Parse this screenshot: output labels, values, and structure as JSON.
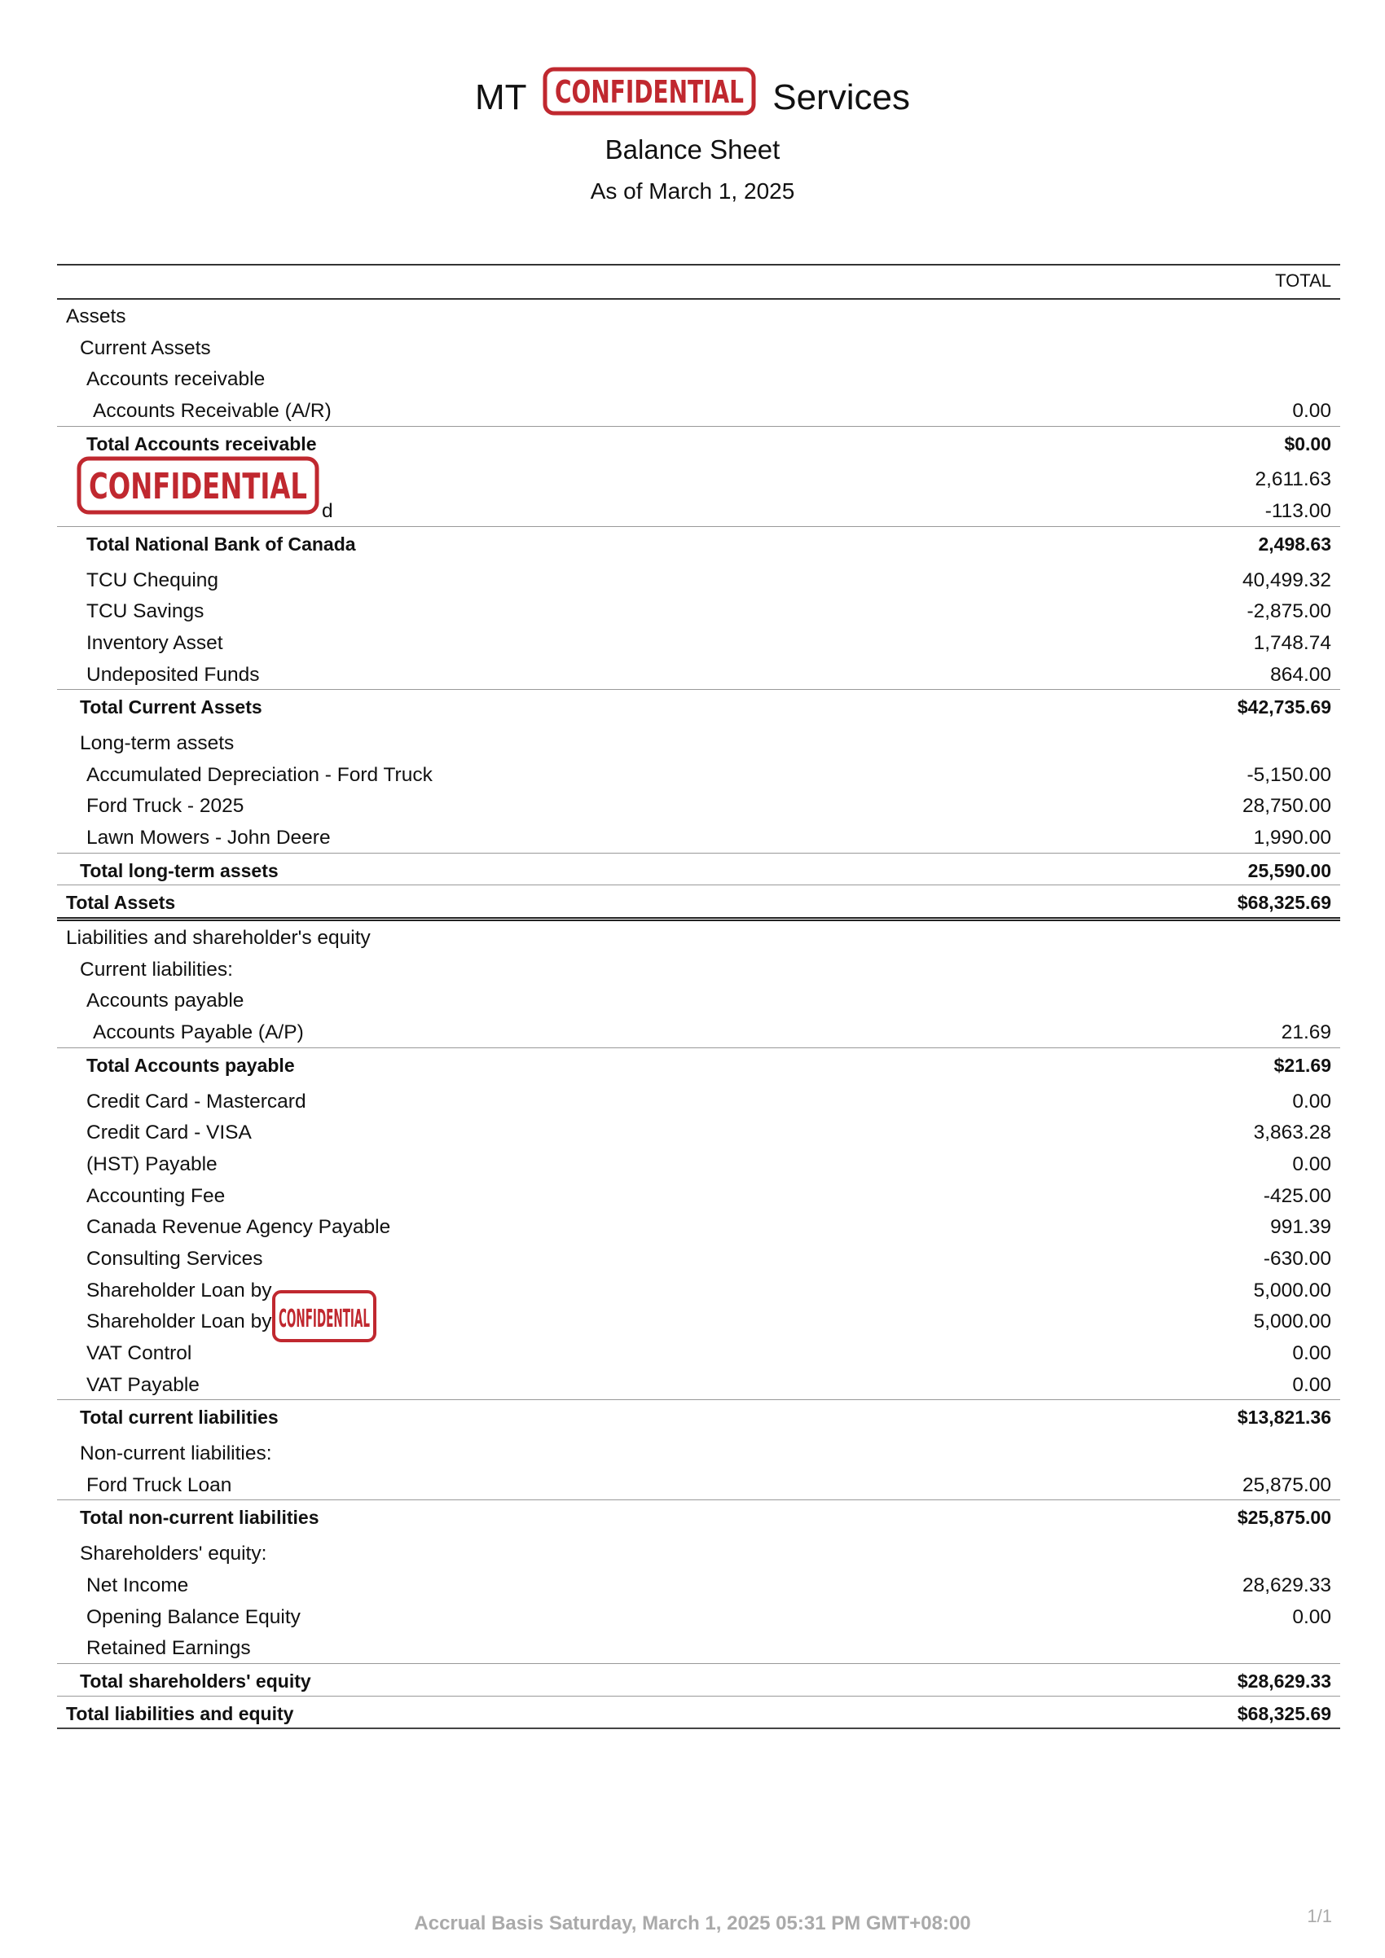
{
  "header": {
    "company_prefix": "MT",
    "company_suffix": "Services",
    "stamp_text": "CONFIDENTIAL",
    "title": "Balance Sheet",
    "date": "As of March 1, 2025"
  },
  "table": {
    "column_header": "TOTAL",
    "rows": [
      {
        "label": "Assets",
        "value": ""
      },
      {
        "label": "Current Assets",
        "value": ""
      },
      {
        "label": "Accounts receivable",
        "value": ""
      },
      {
        "label": "Accounts Receivable (A/R)",
        "value": "0.00"
      },
      {
        "label": "Total Accounts receivable",
        "value": "$0.00"
      },
      {
        "label": "",
        "value": "2,611.63"
      },
      {
        "label": "d",
        "value": "-113.00"
      },
      {
        "label": "Total National Bank of Canada",
        "value": "2,498.63"
      },
      {
        "label": "TCU Chequing",
        "value": "40,499.32"
      },
      {
        "label": "TCU Savings",
        "value": "-2,875.00"
      },
      {
        "label": "Inventory Asset",
        "value": "1,748.74"
      },
      {
        "label": "Undeposited Funds",
        "value": "864.00"
      },
      {
        "label": "Total Current Assets",
        "value": "$42,735.69"
      },
      {
        "label": "Long-term assets",
        "value": ""
      },
      {
        "label": "Accumulated Depreciation - Ford Truck",
        "value": "-5,150.00"
      },
      {
        "label": "Ford Truck - 2025",
        "value": "28,750.00"
      },
      {
        "label": "Lawn Mowers - John Deere",
        "value": "1,990.00"
      },
      {
        "label": "Total long-term assets",
        "value": "25,590.00"
      },
      {
        "label": "Total Assets",
        "value": "$68,325.69"
      },
      {
        "label": "Liabilities and shareholder's equity",
        "value": ""
      },
      {
        "label": "Current liabilities:",
        "value": ""
      },
      {
        "label": "Accounts payable",
        "value": ""
      },
      {
        "label": "Accounts Payable (A/P)",
        "value": "21.69"
      },
      {
        "label": "Total Accounts payable",
        "value": "$21.69"
      },
      {
        "label": "Credit Card - Mastercard",
        "value": "0.00"
      },
      {
        "label": "Credit Card - VISA",
        "value": "3,863.28"
      },
      {
        "label": "(HST) Payable",
        "value": "0.00"
      },
      {
        "label": "Accounting Fee",
        "value": "-425.00"
      },
      {
        "label": "Canada Revenue Agency Payable",
        "value": "991.39"
      },
      {
        "label": "Consulting Services",
        "value": "-630.00"
      },
      {
        "label": "Shareholder Loan by",
        "value": "5,000.00"
      },
      {
        "label": "Shareholder Loan by",
        "value": "5,000.00"
      },
      {
        "label": "VAT Control",
        "value": "0.00"
      },
      {
        "label": "VAT Payable",
        "value": "0.00"
      },
      {
        "label": "Total current liabilities",
        "value": "$13,821.36"
      },
      {
        "label": "Non-current liabilities:",
        "value": ""
      },
      {
        "label": "Ford Truck Loan",
        "value": "25,875.00"
      },
      {
        "label": "Total non-current liabilities",
        "value": "$25,875.00"
      },
      {
        "label": "Shareholders' equity:",
        "value": ""
      },
      {
        "label": "Net Income",
        "value": "28,629.33"
      },
      {
        "label": "Opening Balance Equity",
        "value": "0.00"
      },
      {
        "label": "Retained Earnings",
        "value": ""
      },
      {
        "label": "Total shareholders' equity",
        "value": "$28,629.33"
      },
      {
        "label": "Total liabilities and equity",
        "value": "$68,325.69"
      }
    ]
  },
  "footer": {
    "basis": "Accrual Basis  Saturday, March 1, 2025 05:31 PM GMT+08:00",
    "page": "1/1"
  },
  "colors": {
    "stamp": "#c0282f",
    "footer_text": "#aaaaaa"
  }
}
